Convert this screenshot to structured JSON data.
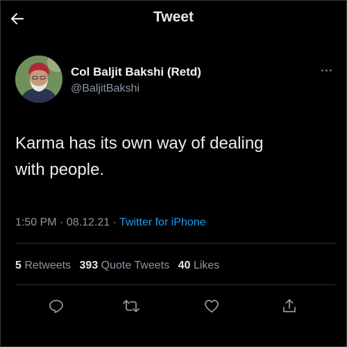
{
  "header": {
    "title": "Tweet",
    "back_icon": "arrow-left-icon"
  },
  "author": {
    "display_name": "Col Baljit Bakshi (Retd)",
    "handle": "@BaljitBakshi",
    "avatar_icon": "profile-photo"
  },
  "more_icon": "ellipsis-icon",
  "tweet": {
    "text_line1": "Karma has its own way of dealing",
    "text_line2": "with people.",
    "time": "1:50 PM",
    "separator": "·",
    "date": "08.12.21",
    "source": "Twitter for iPhone"
  },
  "stats": {
    "retweets_count": "5",
    "retweets_label": "Retweets",
    "quotes_count": "393",
    "quotes_label": "Quote Tweets",
    "likes_count": "40",
    "likes_label": "Likes"
  },
  "actions": {
    "reply_icon": "reply-icon",
    "retweet_icon": "retweet-icon",
    "like_icon": "heart-icon",
    "share_icon": "share-icon"
  },
  "colors": {
    "background": "#000000",
    "text": "#e7e9ea",
    "secondary": "#8b98a5",
    "link": "#1d9bf0"
  }
}
